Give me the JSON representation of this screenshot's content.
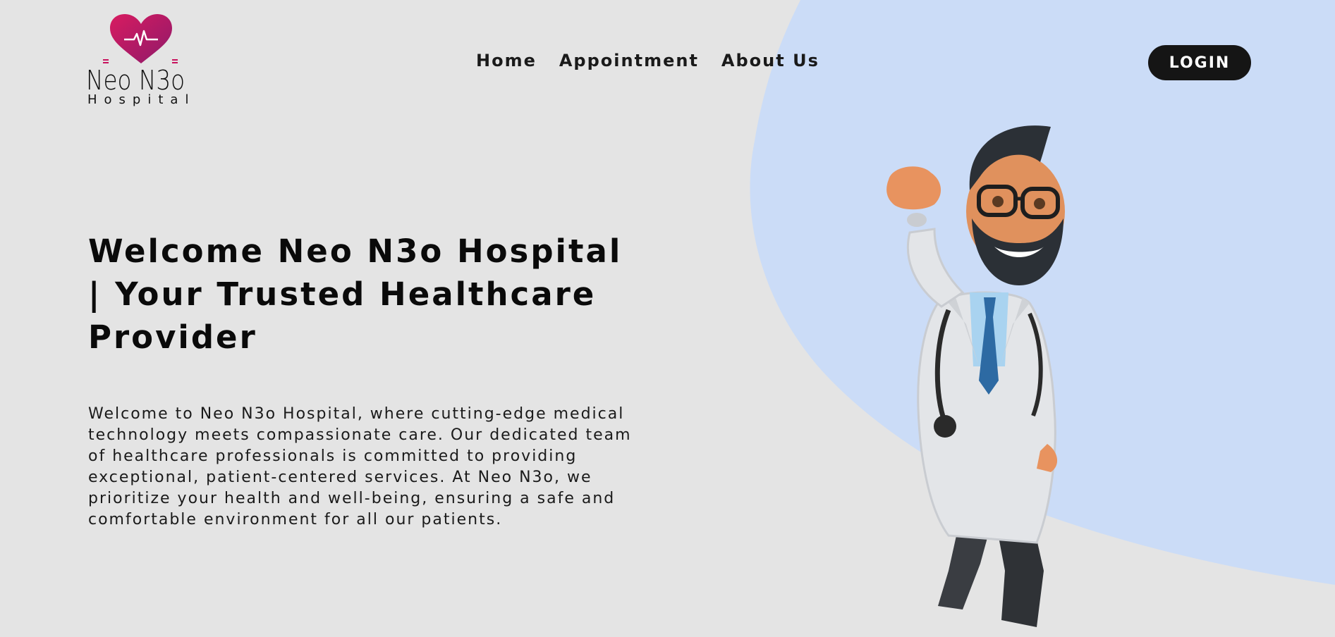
{
  "brand": {
    "name": "Neo N3o",
    "subtitle": "Hospital",
    "heart_color": "#c8125d"
  },
  "nav": {
    "items": [
      "Home",
      "Appointment",
      "About Us"
    ]
  },
  "header": {
    "login_label": "LOGIN"
  },
  "hero": {
    "title": "Welcome Neo N3o Hospital | Your Trusted Healthcare Provider",
    "description": "Welcome to Neo N3o Hospital, where cutting-edge medical technology meets compassionate care. Our dedicated team of healthcare professionals is committed to providing exceptional, patient-centered services. At Neo N3o, we prioritize your health and well-being, ensuring a safe and comfortable environment for all our patients."
  },
  "colors": {
    "background": "#e4e4e4",
    "accent_blob": "#cbdcf7",
    "button": "#151515"
  }
}
